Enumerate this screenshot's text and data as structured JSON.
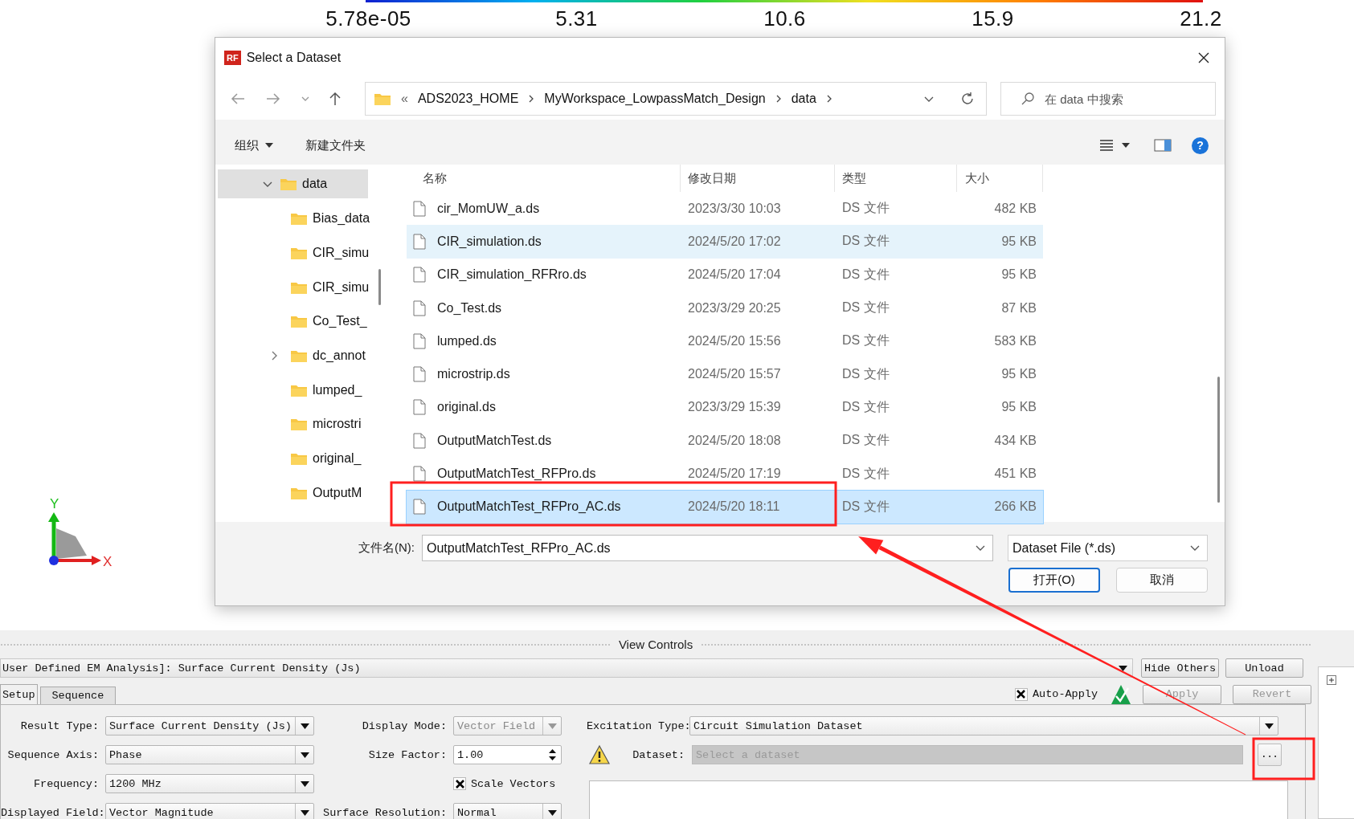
{
  "colorbar": {
    "ticks": [
      "5.78e-05",
      "5.31",
      "10.6",
      "15.9",
      "21.2"
    ]
  },
  "axes": {
    "y_label": "Y",
    "x_label": "X"
  },
  "dialog": {
    "badge": "RF",
    "title": "Select a Dataset",
    "address": {
      "prefix": "«",
      "crumbs": [
        "ADS2023_HOME",
        "MyWorkspace_LowpassMatch_Design",
        "data"
      ]
    },
    "search": {
      "placeholder": "在 data 中搜索"
    },
    "toolbar": {
      "organize": "组织",
      "new_folder": "新建文件夹",
      "help": "?"
    },
    "tree": [
      {
        "label": "data",
        "expanded": true,
        "selected": true,
        "children": [
          {
            "label": "Bias_data"
          },
          {
            "label": "CIR_simu"
          },
          {
            "label": "CIR_simu"
          },
          {
            "label": "Co_Test_"
          },
          {
            "label": "dc_annot",
            "expanded": false
          },
          {
            "label": "lumped_"
          },
          {
            "label": "microstri"
          },
          {
            "label": "original_"
          },
          {
            "label": "OutputM"
          }
        ]
      }
    ],
    "columns": [
      "名称",
      "修改日期",
      "类型",
      "大小"
    ],
    "files": [
      {
        "name": "cir_MomUW_a.ds",
        "modified": "2023/3/30 10:03",
        "type": "DS 文件",
        "size": "482 KB",
        "selected": false,
        "hovered": false
      },
      {
        "name": "CIR_simulation.ds",
        "modified": "2024/5/20 17:02",
        "type": "DS 文件",
        "size": "95 KB",
        "selected": false,
        "hovered": true
      },
      {
        "name": "CIR_simulation_RFRro.ds",
        "modified": "2024/5/20 17:04",
        "type": "DS 文件",
        "size": "95 KB",
        "selected": false,
        "hovered": false
      },
      {
        "name": "Co_Test.ds",
        "modified": "2023/3/29 20:25",
        "type": "DS 文件",
        "size": "87 KB",
        "selected": false,
        "hovered": false
      },
      {
        "name": "lumped.ds",
        "modified": "2024/5/20 15:56",
        "type": "DS 文件",
        "size": "583 KB",
        "selected": false,
        "hovered": false
      },
      {
        "name": "microstrip.ds",
        "modified": "2024/5/20 15:57",
        "type": "DS 文件",
        "size": "95 KB",
        "selected": false,
        "hovered": false
      },
      {
        "name": "original.ds",
        "modified": "2023/3/29 15:39",
        "type": "DS 文件",
        "size": "95 KB",
        "selected": false,
        "hovered": false
      },
      {
        "name": "OutputMatchTest.ds",
        "modified": "2024/5/20 18:08",
        "type": "DS 文件",
        "size": "434 KB",
        "selected": false,
        "hovered": false
      },
      {
        "name": "OutputMatchTest_RFPro.ds",
        "modified": "2024/5/20 17:19",
        "type": "DS 文件",
        "size": "451 KB",
        "selected": false,
        "hovered": false
      },
      {
        "name": "OutputMatchTest_RFPro_AC.ds",
        "modified": "2024/5/20 18:11",
        "type": "DS 文件",
        "size": "266 KB",
        "selected": true,
        "hovered": false
      }
    ],
    "file_name": {
      "label": "文件名(N):",
      "value": "OutputMatchTest_RFPro_AC.ds"
    },
    "file_type": "Dataset File (*.ds)",
    "buttons": [
      {
        "label": "打开(O)",
        "default": true
      },
      {
        "label": "取消",
        "default": false
      }
    ]
  },
  "view_controls": {
    "title": "View Controls",
    "analysis": "User Defined EM Analysis]: Surface Current Density (Js)",
    "hide_others": "Hide Others",
    "unload": "Unload",
    "tabs": [
      {
        "label": "Setup",
        "selected": true
      },
      {
        "label": "Sequence",
        "selected": false
      }
    ],
    "auto_apply": {
      "label": "Auto-Apply",
      "checked": true
    },
    "actions": [
      {
        "label": "Apply",
        "disabled": true
      },
      {
        "label": "Revert",
        "disabled": true
      }
    ],
    "left_fields": [
      {
        "label": "Result Type:",
        "value": "Surface Current Density (Js)"
      },
      {
        "label": "Sequence Axis:",
        "value": "Phase"
      },
      {
        "label": "Frequency:",
        "value": "1200 MHz"
      },
      {
        "label": "Displayed Field:",
        "value": "Vector Magnitude"
      }
    ],
    "middle_fields": [
      {
        "kind": "combo",
        "label": "Display Mode:",
        "value": "Vector Field",
        "disabled": true
      },
      {
        "kind": "spin",
        "label": "Size Factor:",
        "value": "1.00",
        "disabled": false
      },
      {
        "kind": "check",
        "label": "Scale Vectors",
        "checked": true,
        "disabled": false
      },
      {
        "kind": "combo",
        "label": "Surface Resolution:",
        "value": "Normal",
        "disabled": false
      }
    ],
    "excitation": {
      "label": "Excitation Type:",
      "value": "Circuit Simulation Dataset"
    },
    "dataset": {
      "label": "Dataset:",
      "placeholder": "Select a dataset",
      "browse": "..."
    }
  }
}
